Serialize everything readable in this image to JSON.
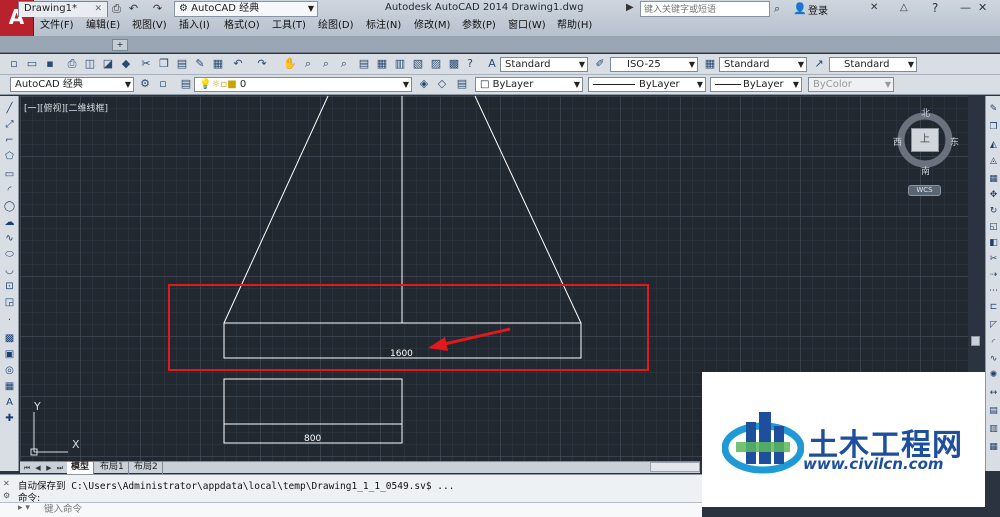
{
  "window": {
    "app_logo": "A",
    "title": "Autodesk AutoCAD 2014    Drawing1.dwg",
    "workspace": "AutoCAD 经典",
    "search_placeholder": "键入关键字或短语",
    "login": "登录"
  },
  "menus": [
    "文件(F)",
    "编辑(E)",
    "视图(V)",
    "插入(I)",
    "格式(O)",
    "工具(T)",
    "绘图(D)",
    "标注(N)",
    "修改(M)",
    "参数(P)",
    "窗口(W)",
    "帮助(H)"
  ],
  "document_tab": "Drawing1*",
  "toolbar_styles": {
    "text_style": "Standard",
    "dim_style": "ISO-25",
    "table_style": "Standard",
    "multileader_style": "Standard"
  },
  "properties_bar": {
    "workspace": "AutoCAD 经典",
    "layer": "0",
    "color": "ByLayer",
    "linetype": "ByLayer",
    "lineweight": "ByLayer",
    "plot_style": "ByColor"
  },
  "viewport_label": "[一][俯视][二维线框]",
  "viewcube": {
    "north": "北",
    "south": "南",
    "west": "西",
    "east": "东",
    "face": "上",
    "wcs": "WCS"
  },
  "ucs": {
    "x": "X",
    "y": "Y"
  },
  "dimensions": {
    "top_width": "1600",
    "bottom_width": "800"
  },
  "layout_tabs": [
    "模型",
    "布局1",
    "布局2"
  ],
  "command": {
    "history_line": "自动保存到 C:\\Users\\Administrator\\appdata\\local\\temp\\Drawing1_1_1_0549.sv$ ...",
    "prompt": "命令:",
    "input_placeholder": "键入命令"
  },
  "watermark": {
    "name": "土木工程网",
    "url": "www.civilcn.com"
  },
  "colors": {
    "highlight_box": "#e0191c",
    "arrow": "#e0191c",
    "lines": "#ffffff",
    "canvas": "#212830"
  }
}
